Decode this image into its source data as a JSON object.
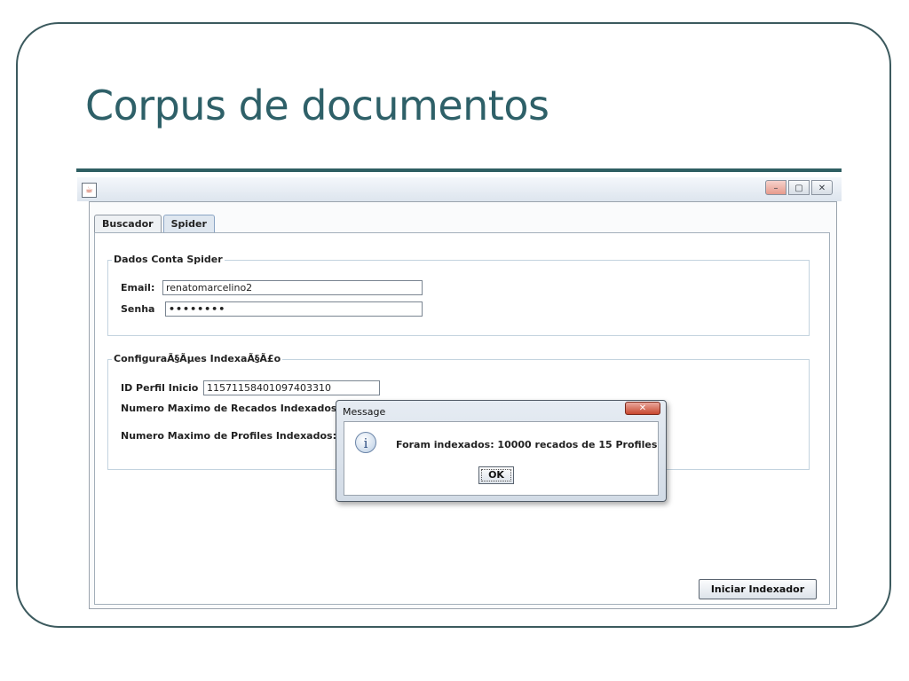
{
  "slide": {
    "title": "Corpus de documentos"
  },
  "window": {
    "app_icon": "java-icon",
    "controls": {
      "minimize": "–",
      "maximize": "▢",
      "close": "✕"
    }
  },
  "tabs": [
    {
      "label": "Buscador",
      "active": false
    },
    {
      "label": "Spider",
      "active": true
    }
  ],
  "account_group": {
    "title": "Dados Conta Spider",
    "email_label": "Email:",
    "email_value": "renatomarcelino2",
    "password_label": "Senha",
    "password_value": "••••••••"
  },
  "config_group": {
    "title": "ConfiguraÃ§Ãµes IndexaÃ§Ã£o",
    "profile_id_label": "ID Perfil Inicio",
    "profile_id_value": "11571158401097403310",
    "max_recados_label": "Numero Maximo de Recados Indexados:",
    "max_profiles_label": "Numero Maximo de Profiles Indexados:"
  },
  "dialog": {
    "title": "Message",
    "close_glyph": "✕",
    "icon": "info-icon",
    "icon_glyph": "i",
    "message": "Foram indexados: 10000 recados de 15 Profiles",
    "ok_label": "OK"
  },
  "actions": {
    "start_indexer_label": "Iniciar Indexador"
  },
  "colors": {
    "slide_title": "#2e6068",
    "frame": "#3c5a5e",
    "tab_active": "#dfe7f0"
  }
}
